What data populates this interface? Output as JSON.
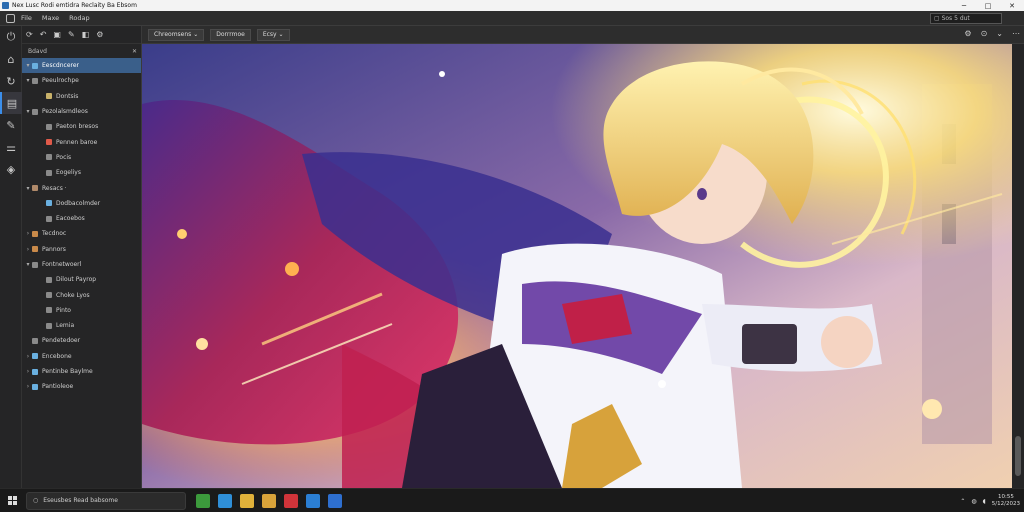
{
  "window": {
    "title": "Nex Lusc Rodi emtidra Reclaity Ba Ebsom",
    "minimize": "─",
    "maximize": "□",
    "close": "✕"
  },
  "menu": {
    "items": [
      "File",
      "Maxe",
      "Rodap"
    ],
    "search_value": "▢ Sos 5 dut"
  },
  "activity_bar": [
    {
      "icon": "power-icon",
      "glyph": "⏻"
    },
    {
      "icon": "home-icon",
      "glyph": "⌂"
    },
    {
      "icon": "refresh-icon",
      "glyph": "↻"
    },
    {
      "icon": "document-icon",
      "glyph": "▤",
      "active": true
    },
    {
      "icon": "tools-icon",
      "glyph": "✎"
    },
    {
      "icon": "sliders-icon",
      "glyph": "⚌"
    },
    {
      "icon": "shield-icon",
      "glyph": "◈"
    }
  ],
  "side_panel": {
    "toolbar_glyphs": [
      "⟳",
      "↶",
      "▣",
      "✎",
      "◧",
      "⚙"
    ],
    "header": "Bdavd",
    "close_glyph": "✕",
    "tree": [
      {
        "label": "Eescdncerer",
        "chev": "▾",
        "indent": 0,
        "color": "#6ab0e0",
        "selected": true
      },
      {
        "label": "Peeulrochpe",
        "chev": "▾",
        "indent": 0,
        "color": "#8a8a8a"
      },
      {
        "label": "Dontsis",
        "chev": "",
        "indent": 1,
        "color": "#c9b26a"
      },
      {
        "label": "Pezolalsmdleos",
        "chev": "▾",
        "indent": 0,
        "color": "#8a8a8a"
      },
      {
        "label": "Paeton bresos",
        "chev": "",
        "indent": 1,
        "color": "#8a8a8a"
      },
      {
        "label": "Pennen baroe",
        "chev": "",
        "indent": 1,
        "color": "#e05a4a"
      },
      {
        "label": "Pocis",
        "chev": "",
        "indent": 1,
        "color": "#8a8a8a"
      },
      {
        "label": "Eogeliys",
        "chev": "",
        "indent": 1,
        "color": "#8a8a8a"
      },
      {
        "label": "Resacs ·",
        "chev": "▾",
        "indent": 0,
        "color": "#b08a6a"
      },
      {
        "label": "Dodbacolmder",
        "chev": "",
        "indent": 1,
        "color": "#6ab0e0"
      },
      {
        "label": "Eacoebos",
        "chev": "",
        "indent": 1,
        "color": "#8a8a8a"
      },
      {
        "label": "Tecdnoc",
        "chev": "›",
        "indent": 0,
        "color": "#c98a4a"
      },
      {
        "label": "Pannors",
        "chev": "›",
        "indent": 0,
        "color": "#c98a4a"
      },
      {
        "label": "Fontnetwoerl",
        "chev": "▾",
        "indent": 0,
        "color": "#8a8a8a"
      },
      {
        "label": "Dilout Payrop",
        "chev": "",
        "indent": 1,
        "color": "#8a8a8a"
      },
      {
        "label": "Choke Lyos",
        "chev": "",
        "indent": 1,
        "color": "#8a8a8a"
      },
      {
        "label": "Pinto",
        "chev": "",
        "indent": 1,
        "color": "#8a8a8a"
      },
      {
        "label": "Lemia",
        "chev": "",
        "indent": 1,
        "color": "#8a8a8a"
      },
      {
        "label": "Pendetedoer",
        "chev": "",
        "indent": 0,
        "color": "#8a8a8a"
      },
      {
        "label": "Encebone",
        "chev": "›",
        "indent": 0,
        "color": "#6ab0e0"
      },
      {
        "label": "Pentinbe Baylme",
        "chev": "›",
        "indent": 0,
        "color": "#6ab0e0"
      },
      {
        "label": "Pantioleoe",
        "chev": "›",
        "indent": 0,
        "color": "#6ab0e0"
      }
    ]
  },
  "editor_toolbar": {
    "view_select": "Chreomsens  ⌄",
    "btn2": "Dorrrmoe",
    "btn3": "Ecsy  ⌄",
    "right_glyphs": [
      "⚙",
      "⊙",
      "⌄",
      "⋯"
    ]
  },
  "taskbar": {
    "search_placeholder": "Eseusbes Read babsome",
    "apps": [
      {
        "name": "browser-app-icon",
        "color": "#3c9a3c"
      },
      {
        "name": "edge-app-icon",
        "color": "#2f8fd8"
      },
      {
        "name": "folder-app-icon",
        "color": "#e0b13a"
      },
      {
        "name": "files-app-icon",
        "color": "#d9a33a"
      },
      {
        "name": "red-app-icon",
        "color": "#d0343a"
      },
      {
        "name": "blue-app-icon",
        "color": "#2b7fd4"
      },
      {
        "name": "store-app-icon",
        "color": "#2e6fcf"
      }
    ],
    "tray_time": "10:55",
    "tray_date": "5/12/2023"
  }
}
